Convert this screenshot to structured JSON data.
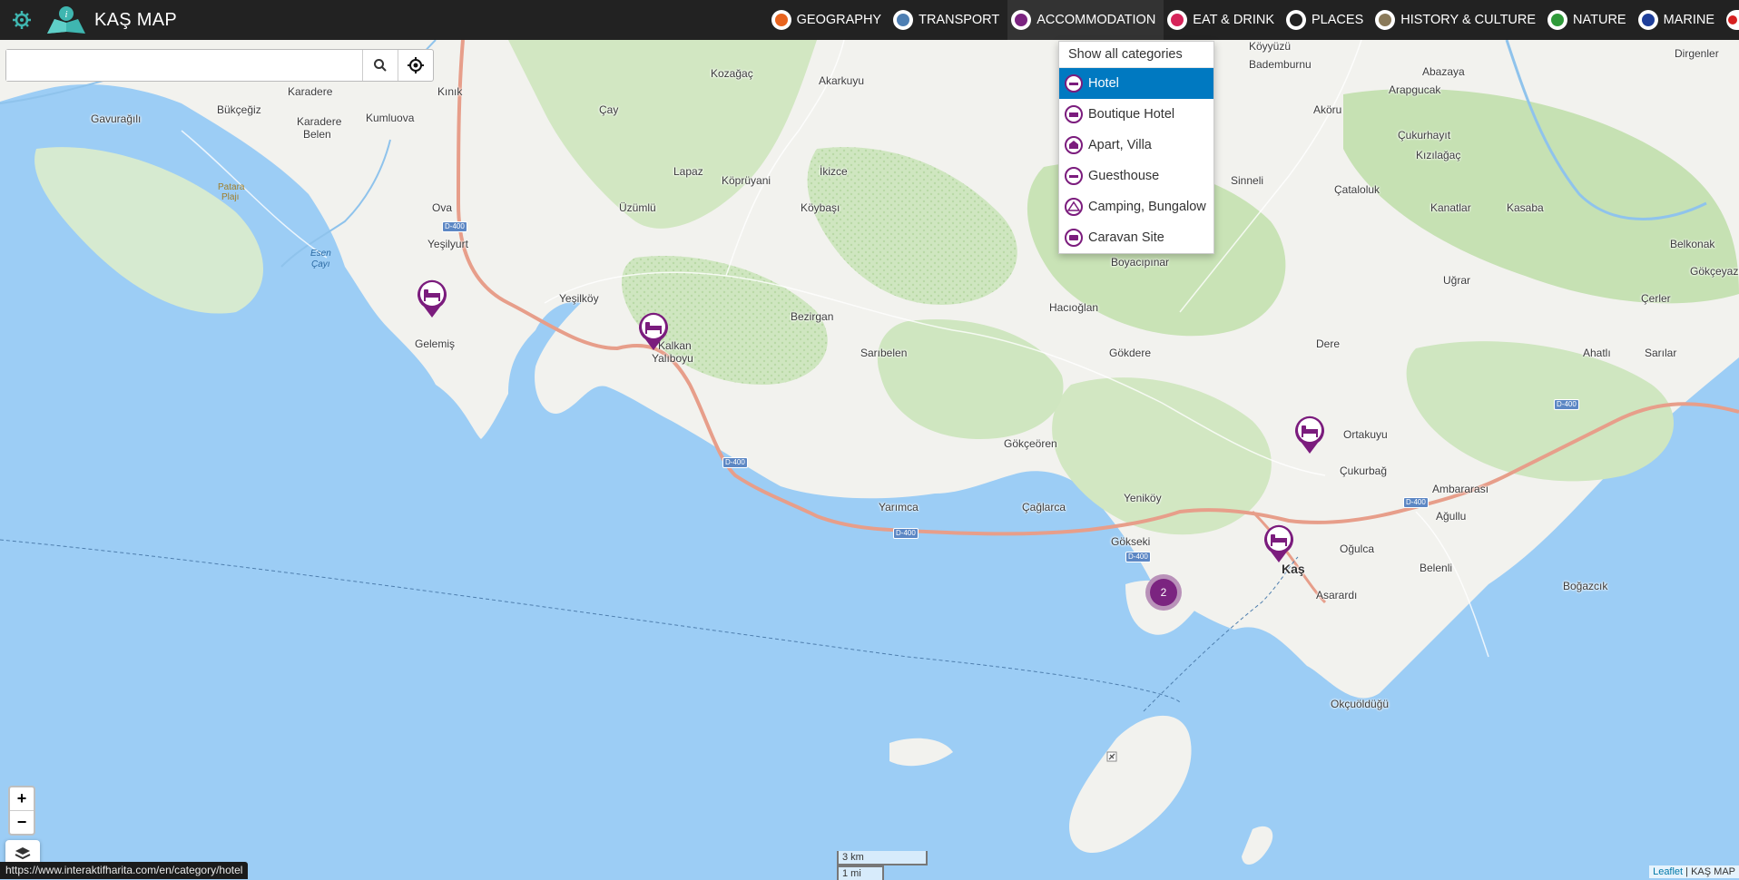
{
  "brand": {
    "name": "KAŞ MAP"
  },
  "nav": [
    {
      "label": "GEOGRAPHY",
      "icon": "sun-icon",
      "color": "#e8641f"
    },
    {
      "label": "TRANSPORT",
      "icon": "bus-icon",
      "color": "#4e7fb3"
    },
    {
      "label": "ACCOMMODATION",
      "icon": "bed-icon",
      "color": "#7b2480"
    },
    {
      "label": "EAT & DRINK",
      "icon": "cutlery-icon",
      "color": "#d6245a"
    },
    {
      "label": "PLACES",
      "icon": "house-icon",
      "color": "#222222"
    },
    {
      "label": "HISTORY & CULTURE",
      "icon": "column-icon",
      "color": "#8a7a5a"
    },
    {
      "label": "NATURE",
      "icon": "leaf-icon",
      "color": "#2f9a3a"
    },
    {
      "label": "MARINE",
      "icon": "anchor-icon",
      "color": "#1f3f9a"
    }
  ],
  "search": {
    "placeholder": "",
    "value": ""
  },
  "dropdown": {
    "header": "Show all categories",
    "items": [
      {
        "label": "Hotel",
        "selected": true
      },
      {
        "label": "Boutique Hotel",
        "selected": false
      },
      {
        "label": "Apart, Villa",
        "selected": false
      },
      {
        "label": "Guesthouse",
        "selected": false
      },
      {
        "label": "Camping, Bungalow",
        "selected": false
      },
      {
        "label": "Caravan Site",
        "selected": false
      }
    ]
  },
  "places": {
    "karadere": "Karadere",
    "bukcegiz": "Bükçeğiz",
    "gavuragili": "Gavurağılı",
    "karadere_belen_1": "Karadere",
    "karadere_belen_2": "Belen",
    "kumluova": "Kumluova",
    "kinik": "Kınık",
    "kozagac": "Kozağaç",
    "akarkuyu": "Akarkuyu",
    "cay": "Çay",
    "koyyuzu": "Köyyüzü",
    "dirgenler": "Dirgenler",
    "bademburnu": "Bademburnu",
    "arapgucak": "Arapgucak",
    "abazaya": "Abazaya",
    "akoru": "Aköru",
    "patara_1": "Patara",
    "patara_2": "Plajı",
    "lapaz": "Lapaz",
    "kopruyani": "Köprüyani",
    "ikizce": "İkizce",
    "cukurhayit": "Çukurhayıt",
    "kizilagac": "Kızılağaç",
    "ova": "Ova",
    "uzumlu": "Üzümlü",
    "koybasi": "Köybaşı",
    "sinneli": "Sinneli",
    "cataloluk": "Çataloluk",
    "kanatlar": "Kanatlar",
    "kasaba": "Kasaba",
    "yesilyurt": "Yeşilyurt",
    "esen_1": "Esen",
    "esen_2": "Çayı",
    "belkonak": "Belkonak",
    "boyacipinar": "Boyacıpınar",
    "gokceyazi": "Gökçeyazı",
    "ugrar": "Uğrar",
    "yesilkoy": "Yeşilköy",
    "hacioglan": "Hacıoğlan",
    "cerler": "Çerler",
    "bezirgan": "Bezirgan",
    "gelemis": "Gelemiş",
    "kalkan_1": "Kalkan",
    "kalkan_2": "Yalıboyu",
    "dere": "Dere",
    "saribelen": "Sarıbelen",
    "gokdere": "Gökdere",
    "ahatli": "Ahatlı",
    "sarilar": "Sarılar",
    "ortakuyu": "Ortakuyu",
    "gokceoren": "Gökçeören",
    "cukurbag": "Çukurbağ",
    "ambararasi": "Ambararası",
    "yenikoy": "Yeniköy",
    "agullu": "Ağullu",
    "yarimca": "Yarımca",
    "caglarca": "Çağlarca",
    "gokseki": "Gökseki",
    "ogulca": "Oğulca",
    "belenli": "Belenli",
    "kas": "Kaş",
    "bogazcik": "Boğazcık",
    "asarardi": "Asarardı",
    "okcouldugu": "Okçuöldüğü"
  },
  "roads": {
    "d400": "D-400"
  },
  "cluster": {
    "count": "2"
  },
  "zoom": {
    "in": "+",
    "out": "−"
  },
  "scale": {
    "km": "3 km",
    "mi": "1 mi"
  },
  "status_url": "https://www.interaktifharita.com/en/category/hotel",
  "attribution": {
    "leaflet": "Leaflet",
    "sep": " | ",
    "brand": "KAŞ MAP"
  }
}
